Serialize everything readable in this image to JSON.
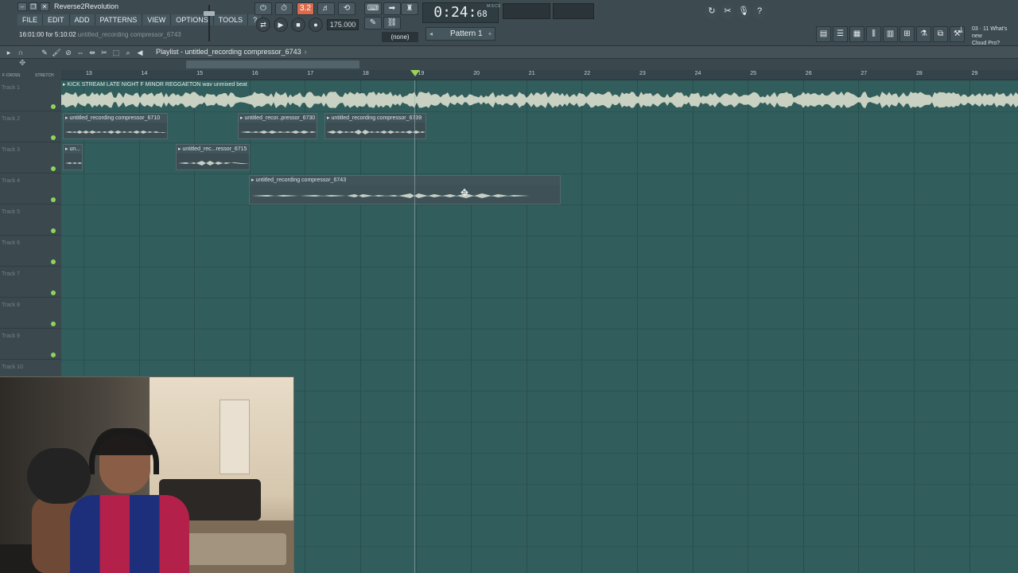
{
  "window": {
    "title": "Reverse2Revolution",
    "hint_time": "16:01:00 for 5:10:02",
    "hint_file": "untitled_recording compressor_6743"
  },
  "menu": [
    "FILE",
    "EDIT",
    "ADD",
    "PATTERNS",
    "VIEW",
    "OPTIONS",
    "TOOLS",
    "?"
  ],
  "transport": {
    "time_main": "0:24",
    "time_sub": "68",
    "time_unit": "M:S:CS",
    "tempo": "175.000",
    "snap": "(none)",
    "pattern": "Pattern 1"
  },
  "news": {
    "line1": "03 · 11  What's new",
    "line2": "Cloud Pro?"
  },
  "playlist": {
    "title": "Playlist - untitled_recording compressor_6743",
    "corner_labels": [
      "F·CROSS",
      "STRETCH"
    ],
    "ruler": [
      "13",
      "14",
      "15",
      "16",
      "17",
      "18",
      "19",
      "20",
      "21",
      "22",
      "23",
      "24",
      "25",
      "26",
      "27",
      "28",
      "29"
    ],
    "tracks": [
      "Track 1",
      "Track 2",
      "Track 3",
      "Track 4",
      "Track 5",
      "Track 6",
      "Track 7",
      "Track 8",
      "Track 9",
      "Track 10"
    ],
    "clips": {
      "beat": "KICK STREAM LATE NIGHT F MINOR REGGAETON wav unmixed beat",
      "t2a": "untitled_recording compressor_6710",
      "t2b": "untitled_recor..pressor_6730",
      "t2c": "untitled_recording compressor_6739",
      "t3a": "un...",
      "t3b": "untitled_rec...ressor_6715",
      "t4": "untitled_recording compressor_6743"
    }
  }
}
